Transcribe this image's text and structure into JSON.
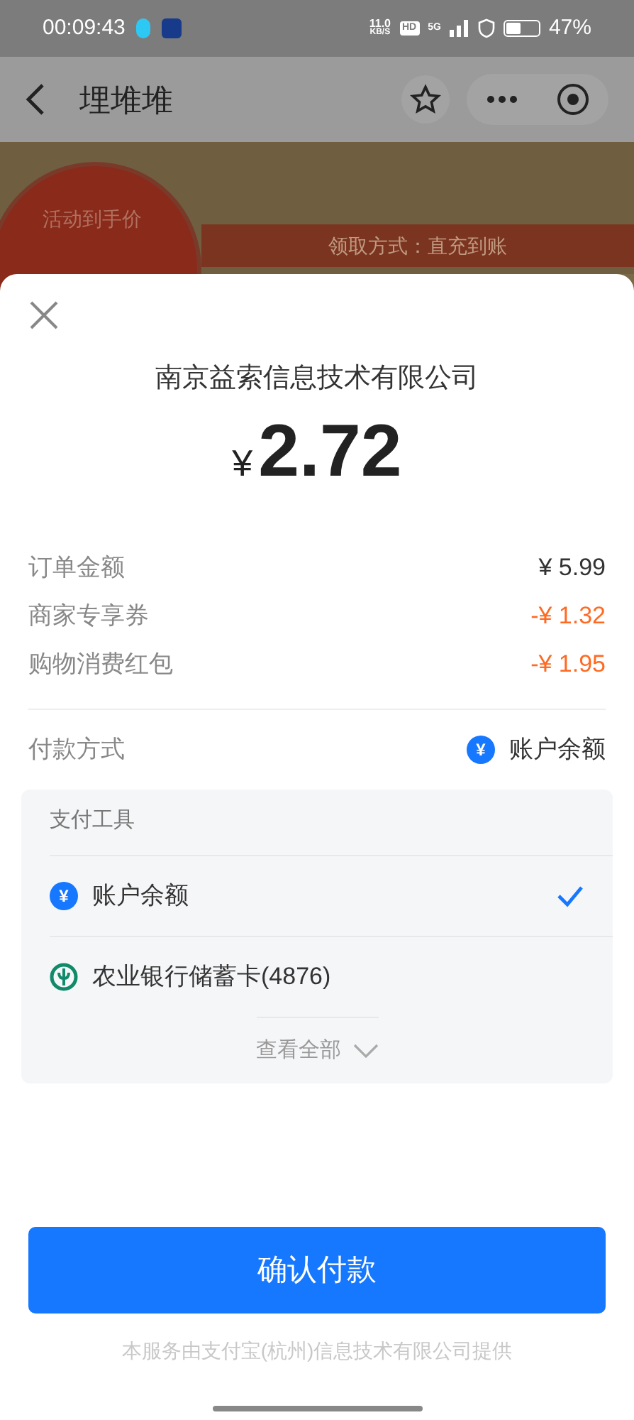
{
  "status_bar": {
    "time": "00:09:43",
    "speed": "11.0",
    "speed_unit": "KB/S",
    "hd": "HD",
    "network": "5G",
    "battery": "47%"
  },
  "nav": {
    "title": "埋堆堆"
  },
  "background_page": {
    "badge_label": "活动到手价",
    "claim_method": "领取方式：直充到账"
  },
  "sheet": {
    "merchant": "南京益索信息技术有限公司",
    "currency": "¥",
    "amount": "2.72",
    "lines": [
      {
        "label": "订单金额",
        "value": "¥ 5.99",
        "kind": "charge"
      },
      {
        "label": "商家专享券",
        "value": "-¥ 1.32",
        "kind": "discount"
      },
      {
        "label": "购物消费红包",
        "value": "-¥ 1.95",
        "kind": "discount"
      }
    ],
    "payment_method": {
      "label": "付款方式",
      "value": "账户余额",
      "icon_text": "¥"
    },
    "tools": {
      "title": "支付工具",
      "options": [
        {
          "label": "账户余额",
          "kind": "balance",
          "icon_text": "¥",
          "selected": true
        },
        {
          "label": "农业银行储蓄卡(4876)",
          "kind": "bank",
          "selected": false
        }
      ],
      "more": "查看全部"
    },
    "confirm": "确认付款",
    "footer": "本服务由支付宝(杭州)信息技术有限公司提供"
  }
}
